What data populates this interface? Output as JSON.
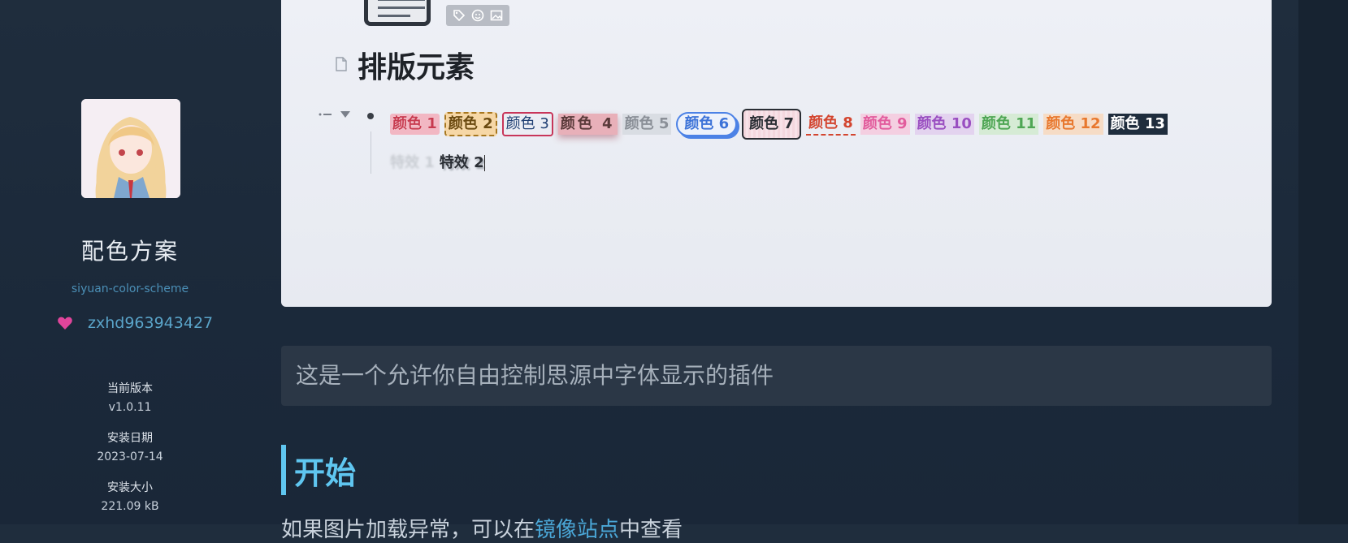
{
  "sidebar": {
    "app_name": "配色方案",
    "app_id": "siyuan-color-scheme",
    "author": "zxhd963943427",
    "version_label": "当前版本",
    "version_value": "v1.0.11",
    "install_date_label": "安装日期",
    "install_date_value": "2023-07-14",
    "install_size_label": "安装大小",
    "install_size_value": "221.09 kB"
  },
  "preview": {
    "doc_title": "排版元素",
    "color_tags": [
      "颜色 1",
      "颜色 2",
      "颜色 3",
      "颜色 4",
      "颜色 5",
      "颜色 6",
      "颜色 7",
      "颜色 8",
      "颜色 9",
      "颜色 10",
      "颜色 11",
      "颜色 12",
      "颜色 13"
    ],
    "effect_tags": [
      "特效 1",
      "特效 2"
    ]
  },
  "readme": {
    "description": "这是一个允许你自由控制思源中字体显示的插件",
    "section_title": "开始",
    "cut_text_before": "如果图片加载异常，可以在",
    "cut_text_link": "镜像站点",
    "cut_text_after": "中查看"
  },
  "colors": {
    "accent": "#5fc6f0",
    "heart": "#e0459b",
    "background": "#1f2d3d"
  }
}
